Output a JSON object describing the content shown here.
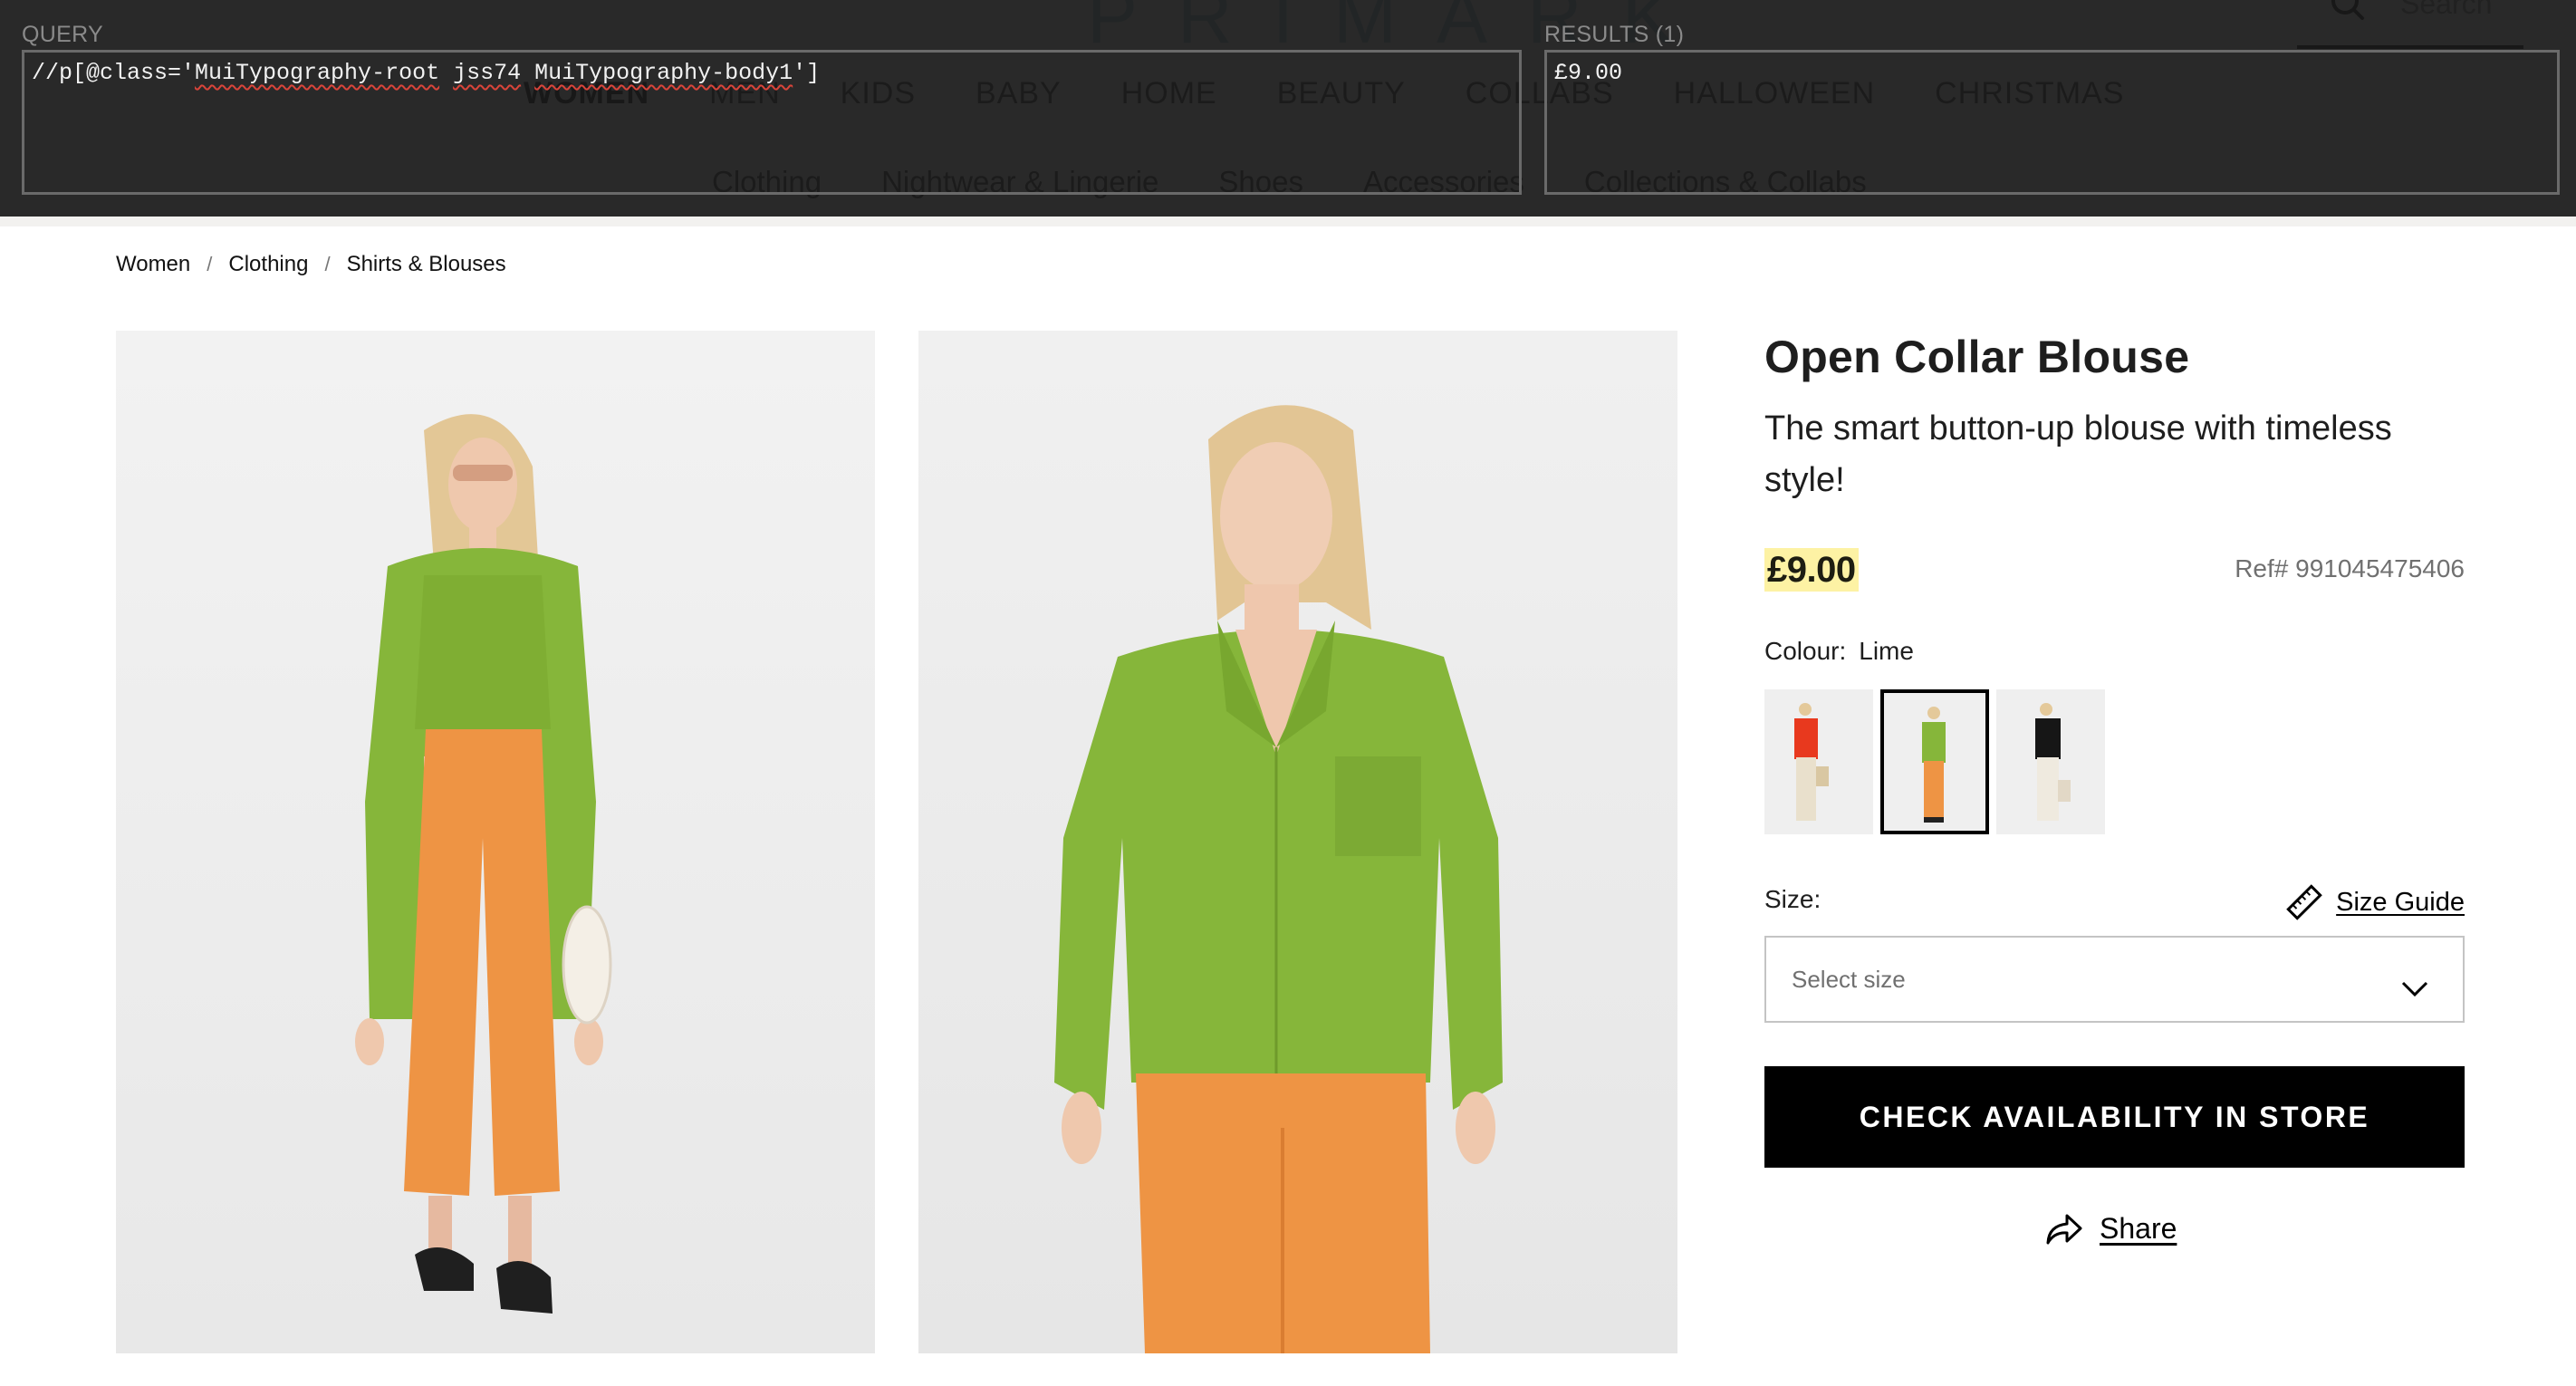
{
  "site": {
    "logo": "PRIMARK",
    "search_placeholder": "Search",
    "main_nav": [
      "WOMEN",
      "MEN",
      "KIDS",
      "BABY",
      "HOME",
      "BEAUTY",
      "COLLABS",
      "HALLOWEEN",
      "CHRISTMAS"
    ],
    "main_nav_active": "WOMEN",
    "sub_nav": [
      "Clothing",
      "Nightwear & Lingerie",
      "Shoes",
      "Accessories",
      "Collections & Collabs"
    ]
  },
  "inspector": {
    "query_label": "QUERY",
    "query_prefix": "//p[@class='",
    "query_tokens": [
      "MuiTypography-root",
      "jss74",
      "MuiTypography-body1"
    ],
    "query_suffix": "']",
    "results_label": "RESULTS (1)",
    "results": [
      "£9.00"
    ]
  },
  "breadcrumb": [
    "Women",
    "Clothing",
    "Shirts & Blouses"
  ],
  "gallery": [
    {
      "alt": "Model wearing lime open collar blouse with orange trousers, full length"
    },
    {
      "alt": "Model wearing lime open collar blouse, close up"
    }
  ],
  "product": {
    "title": "Open Collar Blouse",
    "description": "The smart button-up blouse with timeless style!",
    "price": "£9.00",
    "ref": "Ref# 991045475406",
    "colour_label": "Colour:",
    "colour_value": "Lime",
    "swatches": [
      {
        "name": "Red",
        "top": "#e8391e",
        "bottom": "#e9e0cc",
        "selected": false
      },
      {
        "name": "Lime",
        "top": "#86b63a",
        "bottom": "#ee9444",
        "selected": true
      },
      {
        "name": "Black",
        "top": "#161616",
        "bottom": "#efeadf",
        "selected": false
      }
    ],
    "size_label": "Size:",
    "size_guide": "Size Guide",
    "size_placeholder": "Select size",
    "cta": "CHECK AVAILABILITY IN STORE",
    "share": "Share"
  },
  "colors": {
    "price_highlight": "#fdf2a4",
    "blouse": "#86b63a",
    "trousers": "#ee9444"
  }
}
